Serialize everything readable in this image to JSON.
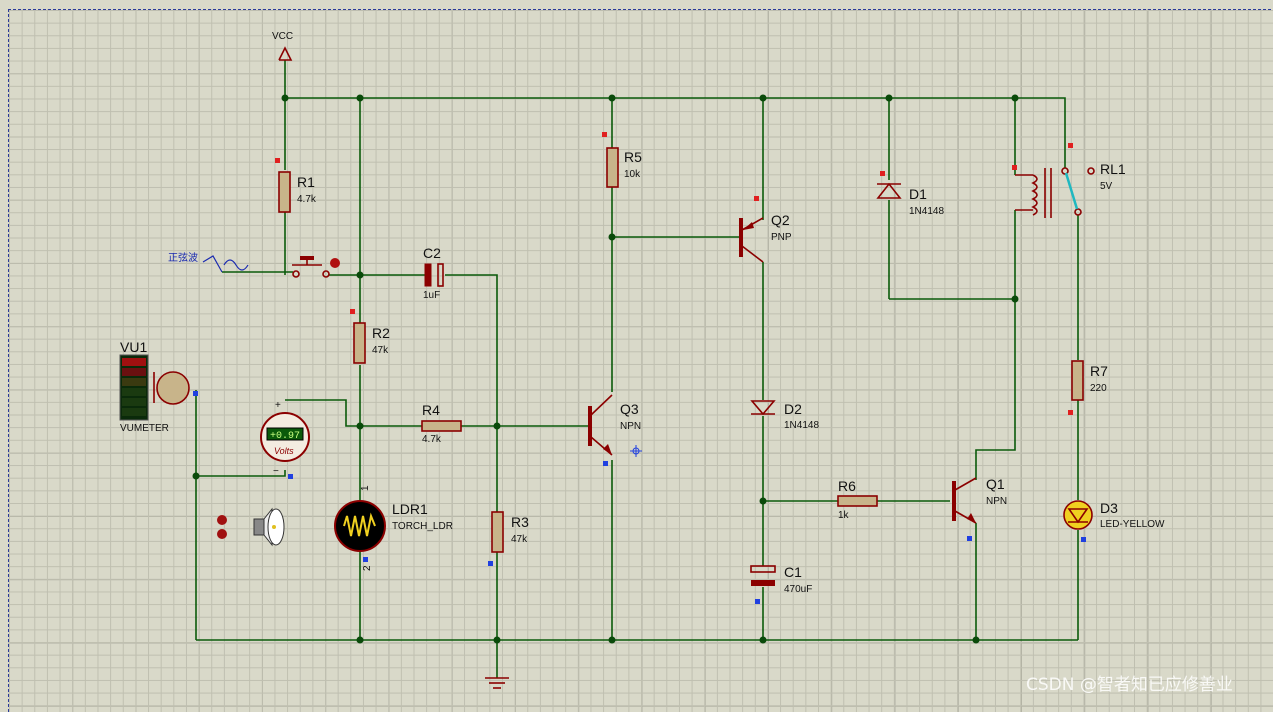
{
  "supply_label": "VCC",
  "signal_label": "正弦波",
  "voltmeter": {
    "reading": "+0.97",
    "unit": "Volts",
    "plus": "+",
    "minus": "−"
  },
  "components": {
    "R1": {
      "ref": "R1",
      "value": "4.7k"
    },
    "R2": {
      "ref": "R2",
      "value": "47k"
    },
    "R3": {
      "ref": "R3",
      "value": "47k"
    },
    "R4": {
      "ref": "R4",
      "value": "4.7k"
    },
    "R5": {
      "ref": "R5",
      "value": "10k"
    },
    "R6": {
      "ref": "R6",
      "value": "1k"
    },
    "R7": {
      "ref": "R7",
      "value": "220"
    },
    "C1": {
      "ref": "C1",
      "value": "470uF"
    },
    "C2": {
      "ref": "C2",
      "value": "1uF"
    },
    "Q1": {
      "ref": "Q1",
      "value": "NPN"
    },
    "Q2": {
      "ref": "Q2",
      "value": "PNP"
    },
    "Q3": {
      "ref": "Q3",
      "value": "NPN"
    },
    "D1": {
      "ref": "D1",
      "value": "1N4148"
    },
    "D2": {
      "ref": "D2",
      "value": "1N4148"
    },
    "D3": {
      "ref": "D3",
      "value": "LED-YELLOW"
    },
    "RL1": {
      "ref": "RL1",
      "value": "5V"
    },
    "LDR1": {
      "ref": "LDR1",
      "value": "TORCH_LDR",
      "pin1": "1",
      "pin2": "2"
    },
    "VU1": {
      "ref": "VU1",
      "value": "VUMETER"
    }
  },
  "watermark": "CSDN @智者知已应修善业"
}
